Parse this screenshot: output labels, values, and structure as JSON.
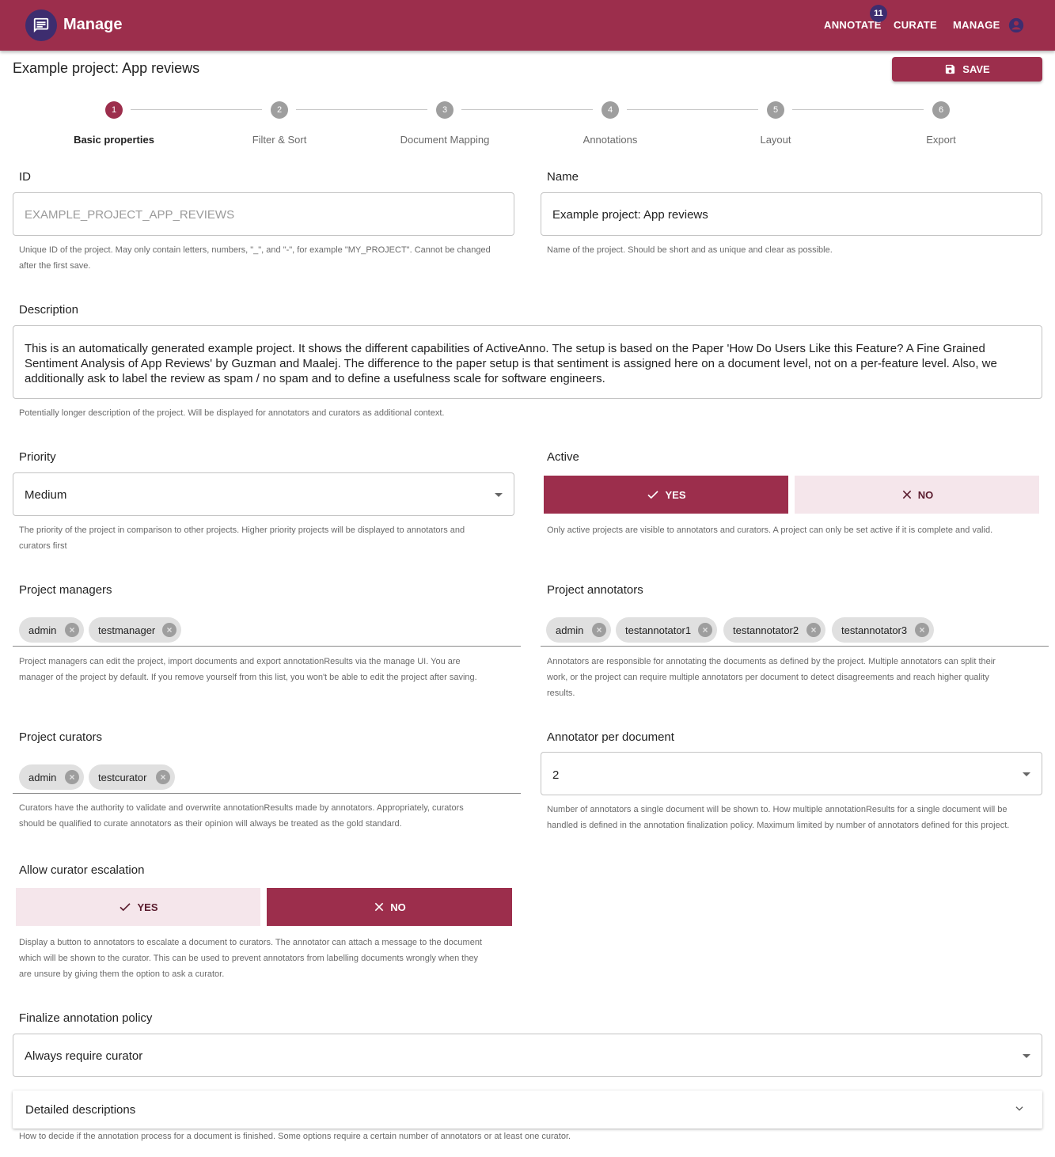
{
  "appbar": {
    "title": "Manage",
    "nav": [
      "ANNOTATE",
      "CURATE",
      "MANAGE"
    ],
    "annotate_badge": "11"
  },
  "page_title": "Example project: App reviews",
  "save_label": "SAVE",
  "stepper": {
    "steps": [
      {
        "num": "1",
        "label": "Basic properties"
      },
      {
        "num": "2",
        "label": "Filter & Sort"
      },
      {
        "num": "3",
        "label": "Document Mapping"
      },
      {
        "num": "4",
        "label": "Annotations"
      },
      {
        "num": "5",
        "label": "Layout"
      },
      {
        "num": "6",
        "label": "Export"
      }
    ],
    "active": 1
  },
  "id_field": {
    "label": "ID",
    "value": "EXAMPLE_PROJECT_APP_REVIEWS",
    "help1": "Unique ID of the project. May only contain letters, numbers, \"_\", and \"-\", for example \"MY_PROJECT\". Cannot be changed",
    "help2": "after the first save."
  },
  "name_field": {
    "label": "Name",
    "value": "Example project: App reviews",
    "help": "Name of the project. Should be short and as unique and clear as possible."
  },
  "description": {
    "label": "Description",
    "value": "This is an automatically generated example project. It shows the different capabilities of ActiveAnno. The setup is based on the Paper 'How Do Users Like this Feature? A Fine Grained Sentiment Analysis of App Reviews' by Guzman and Maalej. The difference to the paper setup is that sentiment is assigned here on a document level, not on a per-feature level. Also, we additionally ask to label the review as spam / no spam and to define a usefulness scale for software engineers.",
    "help": "Potentially longer description of the project. Will be displayed for annotators and curators as additional context."
  },
  "priority": {
    "label": "Priority",
    "value": "Medium",
    "help1": "The priority of the project in comparison to other projects. Higher priority projects will be displayed to annotators and",
    "help2": "curators first"
  },
  "active": {
    "label": "Active",
    "yes": "YES",
    "no": "NO",
    "selected": "yes",
    "help": "Only active projects are visible to annotators and curators. A project can only be set active if it is complete and valid."
  },
  "managers": {
    "label": "Project managers",
    "chips": [
      "admin",
      "testmanager"
    ],
    "help1": "Project managers can edit the project, import documents and export annotationResults via the manage UI. You are",
    "help2": "manager of the project by default. If you remove yourself from this list, you won't be able to edit the project after saving."
  },
  "annotators": {
    "label": "Project annotators",
    "chips": [
      "admin",
      "testannotator1",
      "testannotator2",
      "testannotator3"
    ],
    "help1": "Annotators are responsible for annotating the documents as defined by the project. Multiple annotators can split their",
    "help2": "work, or the project can require multiple annotators per document to detect disagreements and reach higher quality",
    "help3": "results."
  },
  "curators": {
    "label": "Project curators",
    "chips": [
      "admin",
      "testcurator"
    ],
    "help1": "Curators have the authority to validate and overwrite annotationResults made by annotators. Appropriately, curators",
    "help2": "should be qualified to curate annotators as their opinion will always be treated as the gold standard."
  },
  "annotator_per_doc": {
    "label": "Annotator per document",
    "value": "2",
    "help1": "Number of annotators a single document will be shown to. How multiple annotationResults for a single document will be",
    "help2": "handled is defined in the annotation finalization policy. Maximum limited by number of annotators defined for this project."
  },
  "escalation": {
    "label": "Allow curator escalation",
    "yes": "YES",
    "no": "NO",
    "selected": "no",
    "help1": "Display a button to annotators to escalate a document to curators. The annotator can attach a message to the document",
    "help2": "which will be shown to the curator. This can be used to prevent annotators from labelling documents wrongly when they",
    "help3": "are unsure by giving them the option to ask a curator."
  },
  "finalize": {
    "label": "Finalize annotation policy",
    "value": "Always require curator",
    "accordion": "Detailed descriptions",
    "help": "How to decide if the annotation process for a document is finished. Some options require a certain number of annotators or at least one curator."
  },
  "colors": {
    "primary": "#9c2e4c",
    "secondary": "#3d2d6f",
    "toggle_off_bg": "#f5e6eb"
  }
}
